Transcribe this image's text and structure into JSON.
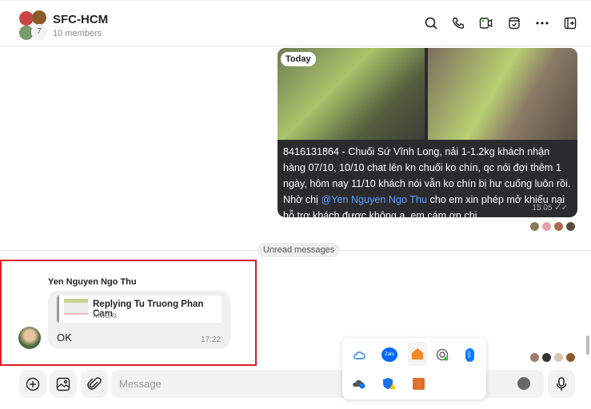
{
  "header": {
    "title": "SFC-HCM",
    "members": "10 members",
    "avatar_count": "7"
  },
  "message1": {
    "date_chip": "Today",
    "text_before": "8416131864 - Chuối Sứ Vĩnh Long, nải 1-1.2kg khách nhận hàng 07/10, 10/10 chat lên kn chuối ko chín, qc nói đợi thêm 1 ngày, hôm nay 11/10 khách nói vẫn ko chín bị hư cuống luôn rồi. Nhờ chị ",
    "mention": "@Yen Nguyen Ngo Thu",
    "text_after": " cho em xin phép mở khiếu nại hỗ trợ khách được không ạ, em cám ơn chị",
    "time": "15:05"
  },
  "divider": {
    "label": "Unread messages"
  },
  "message2": {
    "sender": "Yen Nguyen Ngo Thu",
    "reply_title": "Replying Tu Truong Phan Cam",
    "reply_sub": "Media",
    "text": "OK",
    "time": "17:22"
  },
  "composer": {
    "placeholder": "Message"
  },
  "colors": {
    "accent": "#2b2b2e",
    "highlight": "#d61f26",
    "mention": "#5aa2ff"
  }
}
